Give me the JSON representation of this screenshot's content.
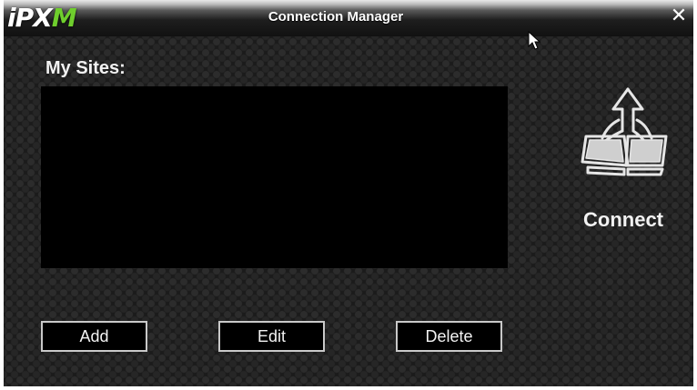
{
  "app": {
    "logo_main": "iPX",
    "logo_accent": "M",
    "accent_color": "#6fce2d",
    "title": "Connection Manager",
    "close_glyph": "✕"
  },
  "sites": {
    "label": "My Sites:",
    "items": []
  },
  "buttons": {
    "add": "Add",
    "edit": "Edit",
    "delete": "Delete"
  },
  "connect": {
    "label": "Connect",
    "icon": "network-connect-icon"
  }
}
